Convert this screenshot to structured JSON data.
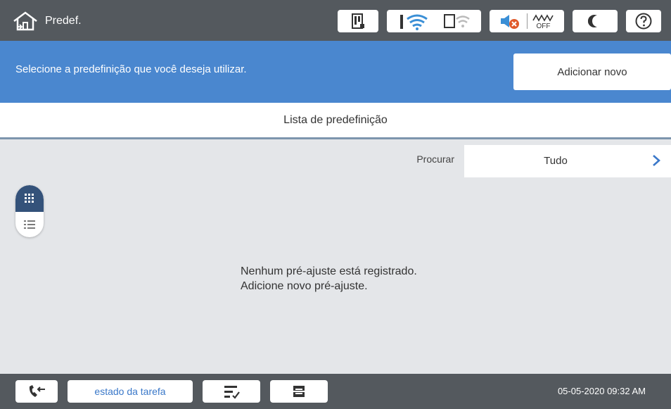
{
  "topbar": {
    "home_title": "Predef.",
    "icons": [
      "home-icon",
      "printer-ink-icon",
      "wifi-icon",
      "wifi-direct-icon",
      "sound-off-icon",
      "eco-off-icon",
      "sleep-moon-icon",
      "help-icon"
    ],
    "eco_label": "OFF"
  },
  "band": {
    "instruction": "Selecione a predefinição que você deseja utilizar.",
    "add_new_label": "Adicionar novo"
  },
  "list": {
    "header": "Lista de predefinição"
  },
  "search": {
    "label": "Procurar",
    "value": "Tudo"
  },
  "view_toggle": {
    "selected": "grid"
  },
  "empty_message": {
    "line1": "Nenhum pré-ajuste está registrado.",
    "line2": "Adicione novo pré-ajuste."
  },
  "bottombar": {
    "job_status_label": "estado da tarefa",
    "datetime": "05-05-2020 09:32 AM"
  },
  "colors": {
    "topbar": "#54595e",
    "band": "#4a87cf",
    "accent": "#3a78c9",
    "background": "#e4e6e9"
  }
}
